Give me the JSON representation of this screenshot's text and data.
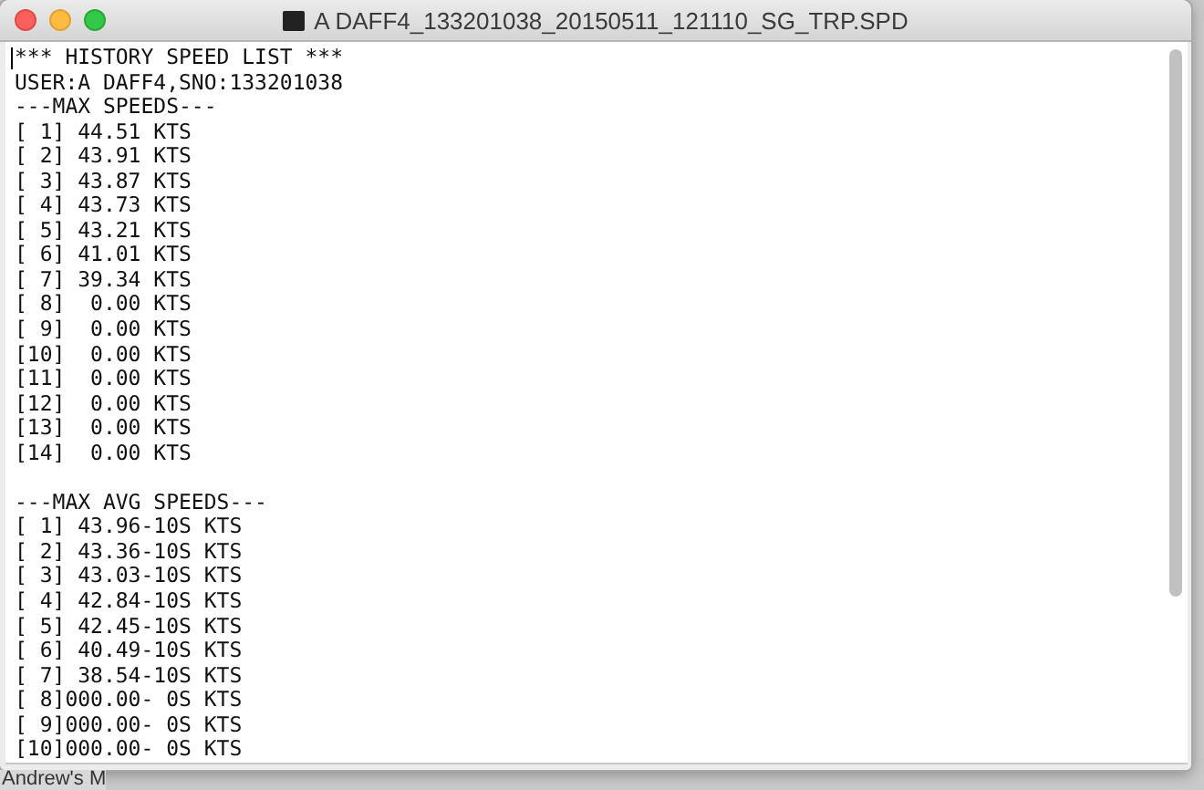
{
  "window": {
    "title": "A DAFF4_133201038_20150511_121110_SG_TRP.SPD"
  },
  "document": {
    "title_line": "*** HISTORY SPEED LIST ***",
    "user_line": "USER:A DAFF4,SNO:133201038",
    "max_speeds_heading": "---MAX SPEEDS---",
    "max_speeds": [
      "[ 1] 44.51 KTS",
      "[ 2] 43.91 KTS",
      "[ 3] 43.87 KTS",
      "[ 4] 43.73 KTS",
      "[ 5] 43.21 KTS",
      "[ 6] 41.01 KTS",
      "[ 7] 39.34 KTS",
      "[ 8]  0.00 KTS",
      "[ 9]  0.00 KTS",
      "[10]  0.00 KTS",
      "[11]  0.00 KTS",
      "[12]  0.00 KTS",
      "[13]  0.00 KTS",
      "[14]  0.00 KTS"
    ],
    "max_avg_speeds_heading": "---MAX AVG SPEEDS---",
    "max_avg_speeds": [
      "[ 1] 43.96-10S KTS",
      "[ 2] 43.36-10S KTS",
      "[ 3] 43.03-10S KTS",
      "[ 4] 42.84-10S KTS",
      "[ 5] 42.45-10S KTS",
      "[ 6] 40.49-10S KTS",
      "[ 7] 38.54-10S KTS",
      "[ 8]000.00- 0S KTS",
      "[ 9]000.00- 0S KTS",
      "[10]000.00- 0S KTS"
    ]
  },
  "background_window": {
    "text": "Andrew's M"
  }
}
